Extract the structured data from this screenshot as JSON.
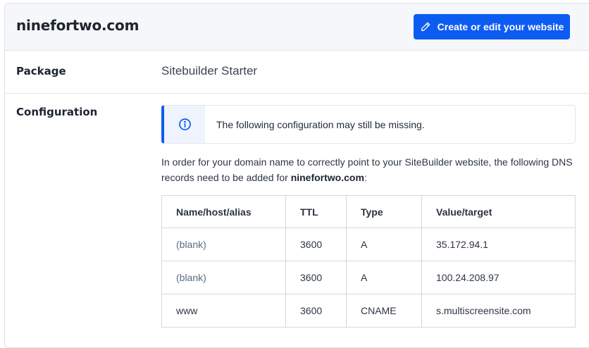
{
  "header": {
    "domain": "ninefortwo.com",
    "create_button_label": "Create or edit your website",
    "create_button_icon": "pencil-icon"
  },
  "package": {
    "label": "Package",
    "value": "Sitebuilder Starter"
  },
  "configuration": {
    "label": "Configuration",
    "alert": {
      "icon": "info-icon",
      "text": "The following configuration may still be missing."
    },
    "description": {
      "before": "In order for your domain name to correctly point to your SiteBuilder website, the following DNS records need to be added for ",
      "domain": "ninefortwo.com",
      "after": ":"
    },
    "table": {
      "headers": [
        "Name/host/alias",
        "TTL",
        "Type",
        "Value/target"
      ],
      "rows": [
        {
          "name": "(blank)",
          "ttl": "3600",
          "type": "A",
          "value": "35.172.94.1"
        },
        {
          "name": "(blank)",
          "ttl": "3600",
          "type": "A",
          "value": "100.24.208.97"
        },
        {
          "name": "www",
          "ttl": "3600",
          "type": "CNAME",
          "value": "s.multiscreensite.com"
        }
      ]
    }
  },
  "colors": {
    "accent": "#0d5cf2",
    "header_bg": "#f5f7fa",
    "muted_cell": "#5a6b85"
  }
}
